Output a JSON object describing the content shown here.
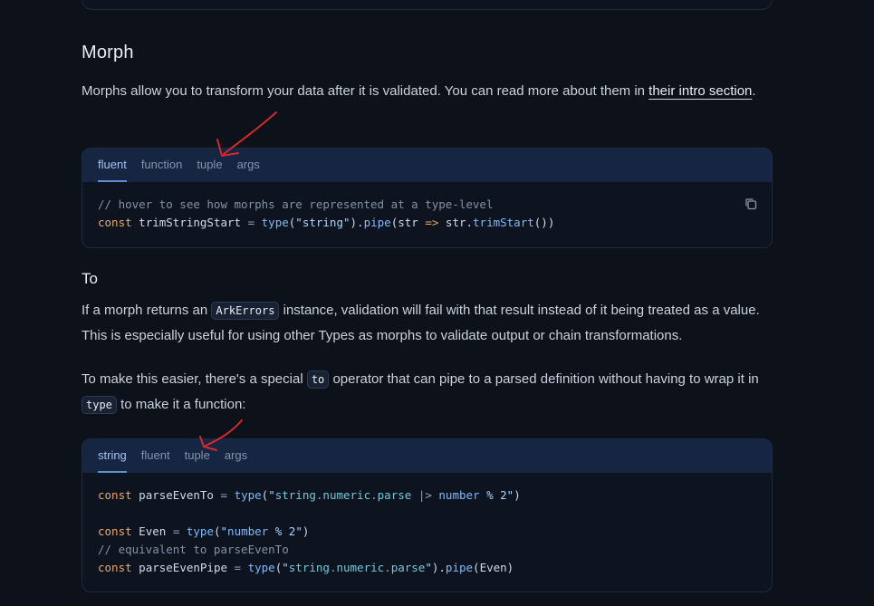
{
  "section": {
    "title": "Morph",
    "intro_text": "Morphs allow you to transform your data after it is validated. You can read more about them in ",
    "intro_link": "their intro section",
    "intro_end": "."
  },
  "codeblock1": {
    "tabs": [
      "fluent",
      "function",
      "tuple",
      "args"
    ],
    "active_tab": "fluent",
    "lines": {
      "comment": "// hover to see how morphs are represented at a type-level",
      "kw": "const",
      "name": "trimStringStart",
      "eq": "=",
      "fn": "type",
      "str": "\"string\"",
      "pipe": "pipe",
      "arg": "str",
      "arrow": "=>",
      "method": "trimStart"
    },
    "copy_icon": "copy-icon"
  },
  "subsection": {
    "title": "To",
    "p1_a": "If a morph returns an ",
    "p1_code": "ArkErrors",
    "p1_b": " instance, validation will fail with that result instead of it being treated as a value. This is especially useful for using other Types as morphs to validate output or chain transformations.",
    "p2_a": "To make this easier, there's a special ",
    "p2_code1": "to",
    "p2_b": " operator that can pipe to a parsed definition without having to wrap it in ",
    "p2_code2": "type",
    "p2_c": " to make it a function:"
  },
  "codeblock2": {
    "tabs": [
      "string",
      "fluent",
      "tuple",
      "args"
    ],
    "active_tab": "string",
    "l1": {
      "kw": "const",
      "name": "parseEvenTo",
      "fn": "type",
      "s1": "string",
      "s2": "numeric",
      "s3": "parse",
      "op": "|>",
      "s4": "number",
      "s5": "% 2"
    },
    "l2": {
      "kw": "const",
      "name": "Even",
      "fn": "type",
      "s1": "number",
      "s2": "% 2"
    },
    "l3": {
      "comment": "// equivalent to parseEvenTo"
    },
    "l4": {
      "kw": "const",
      "name": "parseEvenPipe",
      "fn": "type",
      "s1": "string",
      "s2": "numeric",
      "s3": "parse",
      "pipe": "pipe",
      "arg": "Even"
    }
  },
  "colors": {
    "background": "#0c111a",
    "tab_bar": "#162542",
    "active_tab": "#9fc3f3",
    "annotation_arrow": "#d42a2a"
  }
}
